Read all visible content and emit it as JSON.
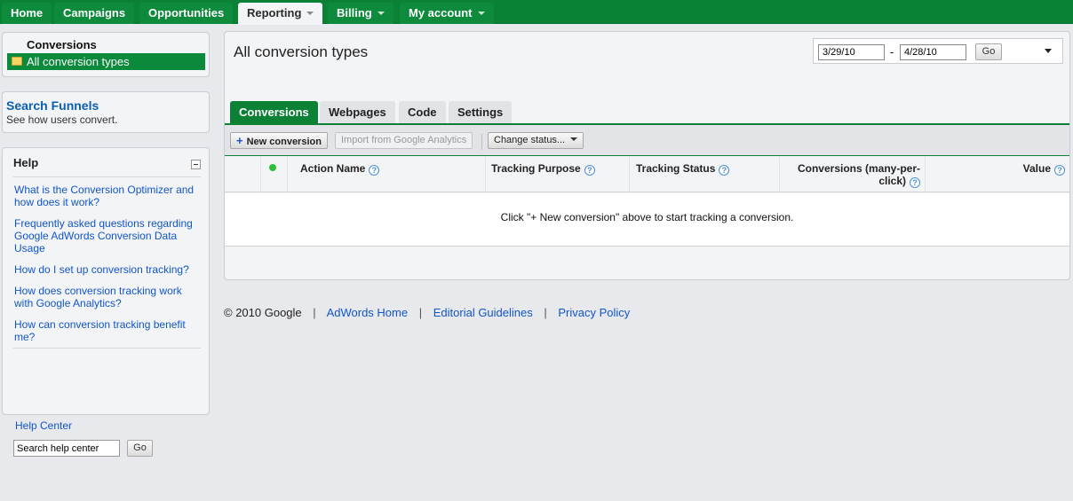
{
  "nav": {
    "tabs": [
      {
        "label": "Home"
      },
      {
        "label": "Campaigns"
      },
      {
        "label": "Opportunities"
      },
      {
        "label": "Reporting"
      },
      {
        "label": "Billing"
      },
      {
        "label": "My account"
      }
    ]
  },
  "sidebar": {
    "conversions": {
      "title": "Conversions",
      "selected": "All conversion types"
    },
    "funnels": {
      "title": "Search Funnels",
      "subtitle": "See how users convert."
    },
    "help": {
      "title": "Help",
      "links": [
        "What is the Conversion Optimizer and how does it work?",
        "Frequently asked questions regarding Google AdWords Conversion Data Usage",
        "How do I set up conversion tracking?",
        "How does conversion tracking work with Google Analytics?",
        "How can conversion tracking benefit me?"
      ],
      "help_center": "Help Center",
      "search_value": "Search help center",
      "go_label": "Go"
    }
  },
  "main": {
    "title": "All conversion types",
    "date_from": "3/29/10",
    "date_to": "4/28/10",
    "date_dash": "-",
    "go_label": "Go",
    "tabs": [
      {
        "label": "Conversions"
      },
      {
        "label": "Webpages"
      },
      {
        "label": "Code"
      },
      {
        "label": "Settings"
      }
    ],
    "toolbar": {
      "new_conversion": "New conversion",
      "import_ga": "Import from Google Analytics",
      "change_status": "Change status..."
    },
    "columns": {
      "action_name": "Action Name",
      "tracking_purpose": "Tracking Purpose",
      "tracking_status": "Tracking Status",
      "conversions_line1": "Conversions (many-per-",
      "conversions_line2": "click)",
      "value": "Value"
    },
    "empty_message": "Click \"+ New conversion\" above to start tracking a conversion."
  },
  "footer": {
    "copyright": "© 2010 Google",
    "links": [
      "AdWords Home",
      "Editorial Guidelines",
      "Privacy Policy"
    ],
    "separator": "|"
  }
}
